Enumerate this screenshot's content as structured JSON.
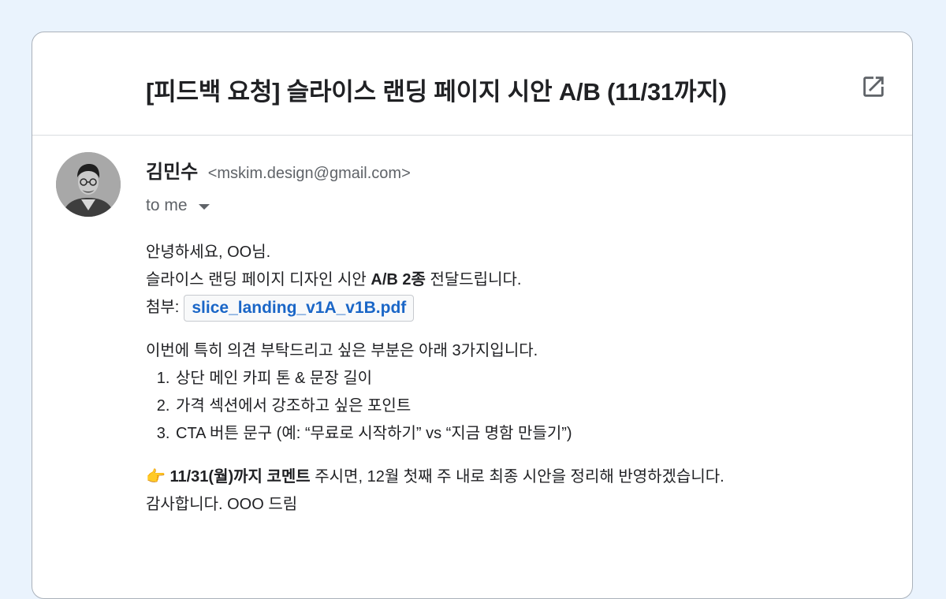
{
  "email": {
    "subject": "[피드백 요청] 슬라이스 랜딩 페이지 시안 A/B (11/31까지)",
    "sender_name": "김민수",
    "sender_email": "<mskim.design@gmail.com>",
    "recipient": "to me",
    "greeting": "안녕하세요, OO님.",
    "intro_prefix": "슬라이스 랜딩 페이지 디자인 시안 ",
    "intro_bold": "A/B 2종",
    "intro_suffix": " 전달드립니다.",
    "attachment_label": "첨부:",
    "attachment_file": "slice_landing_v1A_v1B.pdf",
    "request_line": "이번에 특히 의견 부탁드리고 싶은 부분은 아래 3가지입니다.",
    "items": [
      "상단 메인 카피 톤 & 문장 길이",
      "가격 섹션에서 강조하고 싶은 포인트",
      "CTA 버튼 문구 (예: “무료로 시작하기” vs “지금 명함 만들기”)"
    ],
    "deadline_emoji": "👉",
    "deadline_bold": "11/31(월)까지 코멘트",
    "deadline_suffix": " 주시면, 12월 첫째 주 내로 최종 시안을 정리해 반영하겠습니다.",
    "closing": "감사합니다. OOO 드림"
  },
  "icons": {
    "popout": "open-in-new-icon",
    "caret": "caret-down-icon"
  },
  "colors": {
    "background": "#eaf3fd",
    "link": "#1a66c7",
    "muted": "#5f6368"
  }
}
